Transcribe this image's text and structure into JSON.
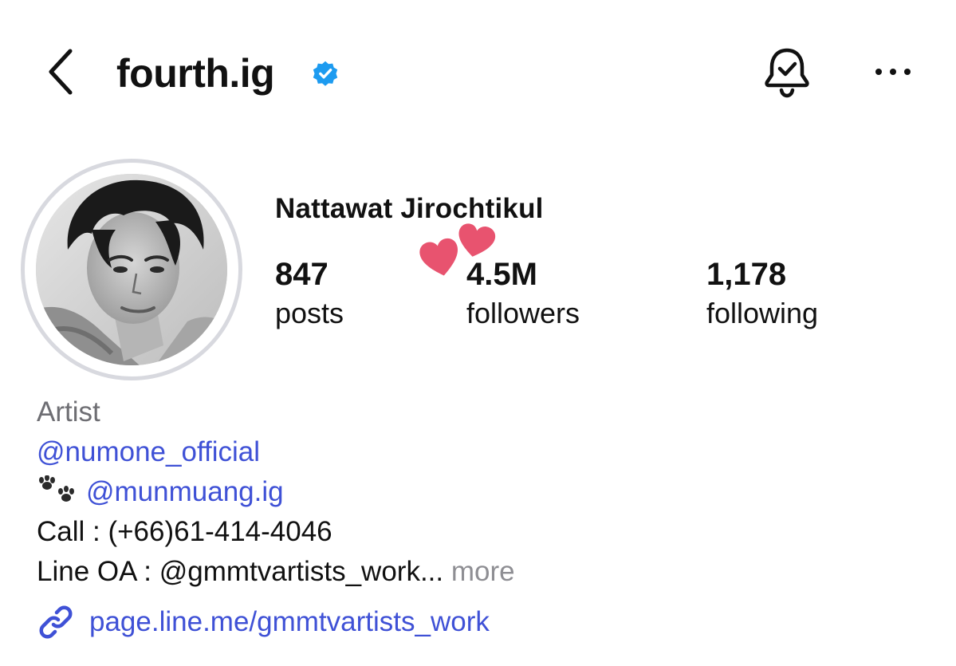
{
  "header": {
    "username": "fourth.ig",
    "icons": {
      "back": "chevron-left-icon",
      "verified": "verified-badge-icon",
      "notifications": "bell-check-icon",
      "more": "more-horizontal-icon"
    }
  },
  "profile": {
    "display_name": "Nattawat Jirochtikul",
    "stats": [
      {
        "value": "847",
        "label": "posts"
      },
      {
        "value": "4.5M",
        "label": "followers"
      },
      {
        "value": "1,178",
        "label": "following"
      }
    ],
    "bio": {
      "category": "Artist",
      "mention_1": "@numone_official",
      "pet_emoji": "🐾",
      "mention_2": "@munmuang.ig",
      "line_call": "Call : (+66)61-414-4046",
      "line_oa": "Line OA : @gmmtvartists_work...",
      "more_label": "more"
    },
    "link": "page.line.me/gmmtvartists_work"
  },
  "colors": {
    "link_blue": "#3f51d6",
    "verified_blue": "#1d9bf0",
    "category_gray": "#6e6e73",
    "avatar_ring": "#d8d9df",
    "heart_pink": "#e8536f"
  }
}
